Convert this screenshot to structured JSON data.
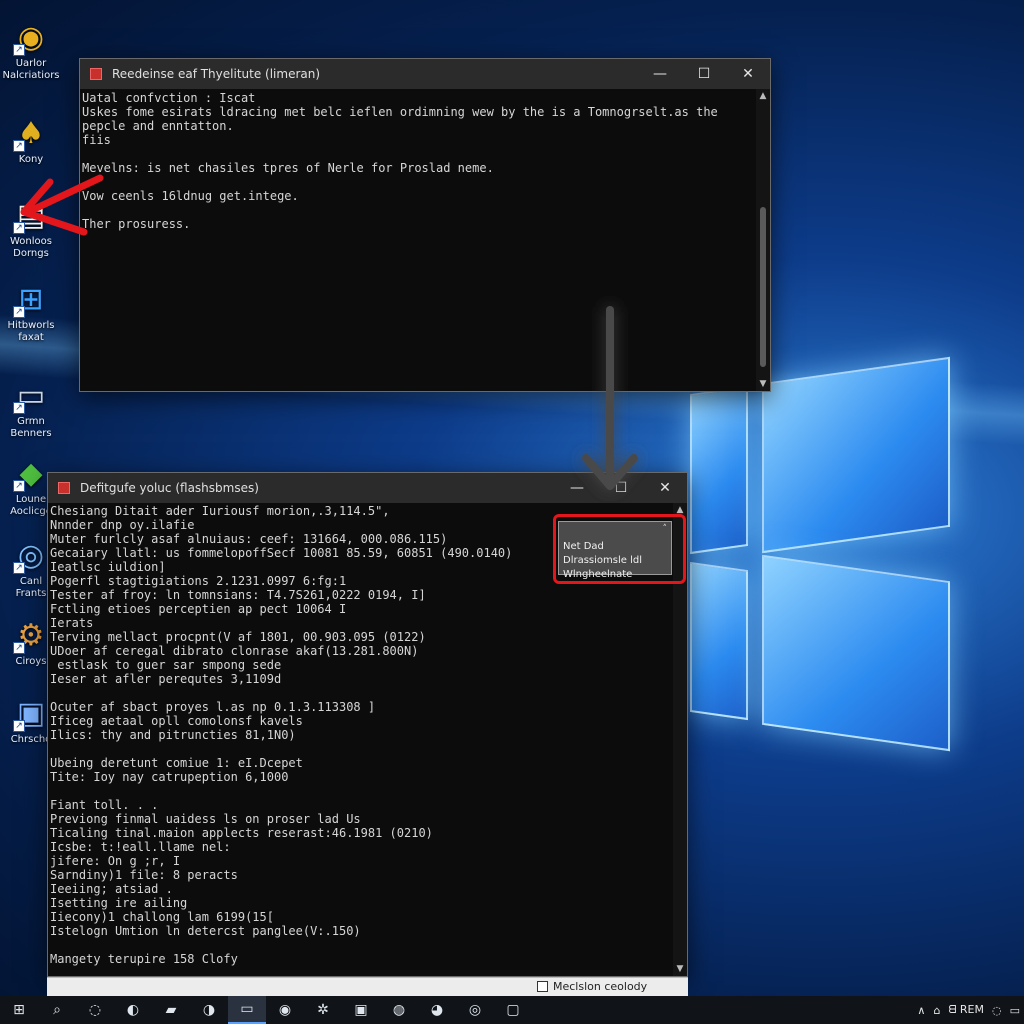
{
  "desktop": {
    "icons": [
      {
        "name": "chrome-icon",
        "glyph": "◉",
        "color": "#e8b020",
        "label": "Uarlor\nNalcriatiors"
      },
      {
        "name": "game-icon",
        "glyph": "♠",
        "color": "#e0b020",
        "label": "Kony"
      },
      {
        "name": "document-icon",
        "glyph": "▤",
        "color": "#f2efe6",
        "label": "Wonloos\nDorngs"
      },
      {
        "name": "windows-shield-icon",
        "glyph": "⊞",
        "color": "#3aa2ff",
        "label": "Hitbworls\nfaxat"
      },
      {
        "name": "drive-icon",
        "glyph": "▭",
        "color": "#c9d6e6",
        "label": "Grmn\nBenners"
      },
      {
        "name": "app-icon",
        "glyph": "◆",
        "color": "#4fbf3f",
        "label": "Loune\nAoclicge"
      },
      {
        "name": "disc-icon",
        "glyph": "◎",
        "color": "#7fc2ff",
        "label": "Canl\nFrants"
      },
      {
        "name": "settings-icon",
        "glyph": "⚙",
        "color": "#e8a040",
        "label": "Ciroys"
      },
      {
        "name": "installer-icon",
        "glyph": "▣",
        "color": "#7fb4ff",
        "label": "Chrscho"
      }
    ]
  },
  "top_window": {
    "title": "Reedeinse eaf Thyelitute (limeran)",
    "controls": {
      "minimize": "—",
      "maximize": "☐",
      "close": "✕"
    },
    "lines": [
      "Uatal confvction : Iscat",
      "Uskes fome esirats ldracing met belc ieflen ordimning wew by the is a Tomnogrselt.as the",
      "pepcle and enntatton.",
      "fiis",
      "",
      "Mevelns: is net chasiles tpres of Nerle for Proslad neme.",
      "",
      "Vow ceenls 16ldnug get.intege.",
      "",
      "Ther prosuress."
    ]
  },
  "bottom_window": {
    "title": "Defitgufe yoluc (flashsbmses)",
    "controls": {
      "minimize": "—",
      "maximize": "☐",
      "close": "✕"
    },
    "lines": [
      "Chesiang Ditait ader Iuriousf morion,.3,114.5\",",
      "Nnnder dnp oy.ilafie",
      "Muter furlcly asaf alnuiaus: ceef: 131664, 000.086.115)",
      "Gecaiary llatl: us fommelopoffSecf 10081 85.59, 60851 (490.0140)",
      "Ieatlsc iuldion]",
      "Pogerfl stagtigiations 2.1231.0997 6:fg:1",
      "Tester af froy: ln tomnsians: T4.7S261,0222 0194, I]",
      "Fctling etioes perceptien ap pect 10064 I",
      "Ierats",
      "Terving mellact procpnt(V af 1801, 00.903.095 (0122)",
      "UDoer af ceregal dibrato clonrase akaf(13.281.800N)",
      " estlask to guer sar smpong sede",
      "Ieser at afler perequtes 3,1109d",
      "",
      "Ocuter af sbact proyes l.as np 0.1.3.113308 ]",
      "Ificeg aetaal opll comolonsf kavels",
      "Ilics: thy and pitruncties 81,1N0)",
      "",
      "Ubeing deretunt comiue 1: eI.Dcepet",
      "Tite: Ioy nay catrupeption 6,1000",
      "",
      "Fiant toll. . .",
      "Previong finmal uaidess ls on proser lad Us",
      "Ticaling tinal.maion applects reserast:46.1981 (0210)",
      "Icsbe: t:!eall.llame nel:",
      "jifere: On g ;r, I",
      "Sarndiny)1 file: 8 peracts",
      "Ieeiing; atsiad .",
      "Isetting ire ailing",
      "Iiecony)1 challong lam 6199(15[",
      "Istelogn Umtion ln detercst panglee(V:.150)",
      "",
      "Mangety terupire 158 Clofy"
    ]
  },
  "tooltip": {
    "text": "Net Dad\nDlrassiomsle ldl\nWlngheelnate",
    "close": "˄"
  },
  "statusbar": {
    "checkbox_label": "Meclslon ceolody"
  },
  "taskbar": {
    "items": [
      {
        "name": "start-icon",
        "glyph": "⊞",
        "active": false
      },
      {
        "name": "search-icon",
        "glyph": "⌕",
        "active": false
      },
      {
        "name": "task-view-icon",
        "glyph": "◌",
        "active": false
      },
      {
        "name": "edge-icon",
        "glyph": "◐",
        "active": false
      },
      {
        "name": "file-explorer-icon",
        "glyph": "▰",
        "active": false
      },
      {
        "name": "firefox-icon",
        "glyph": "◑",
        "active": false
      },
      {
        "name": "console-icon",
        "glyph": "▭",
        "active": true
      },
      {
        "name": "chrome-taskbar-icon",
        "glyph": "◉",
        "active": false
      },
      {
        "name": "settings-taskbar-icon",
        "glyph": "✲",
        "active": false
      },
      {
        "name": "store-icon",
        "glyph": "▣",
        "active": false
      },
      {
        "name": "xbox-icon",
        "glyph": "◍",
        "active": false
      },
      {
        "name": "browser-icon",
        "glyph": "◕",
        "active": false
      },
      {
        "name": "media-icon",
        "glyph": "◎",
        "active": false
      },
      {
        "name": "tablet-icon",
        "glyph": "▢",
        "active": false
      }
    ],
    "tray": {
      "up_arrow": "∧",
      "network": "⌂",
      "language": "ᗺ REM",
      "volume": "◌",
      "notifications": "▭"
    }
  },
  "colors": {
    "highlight": "#e3161c",
    "console_bg": "#0c0c0c",
    "console_text": "#d6d6d6"
  }
}
